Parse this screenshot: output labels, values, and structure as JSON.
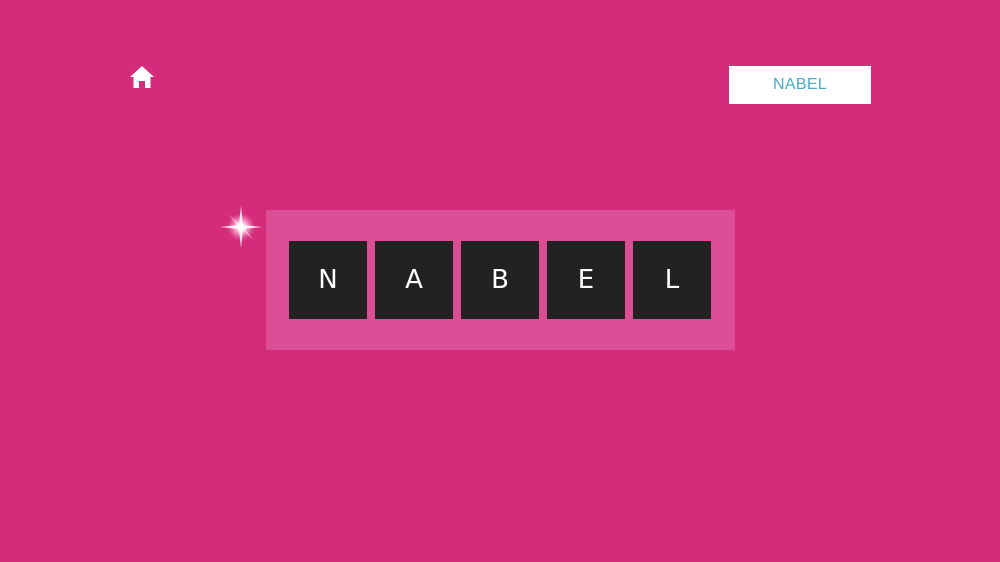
{
  "colors": {
    "background": "#d42c7a",
    "tray": "#db4e96",
    "tile": "#222222",
    "tile_text": "#ffffff",
    "badge_text": "#4aa9c9",
    "home_icon": "#ffffff"
  },
  "header": {
    "home_icon": "home-icon",
    "target_word": "NABEL"
  },
  "board": {
    "tiles": [
      {
        "letter": "N"
      },
      {
        "letter": "A"
      },
      {
        "letter": "B"
      },
      {
        "letter": "E"
      },
      {
        "letter": "L"
      }
    ]
  }
}
